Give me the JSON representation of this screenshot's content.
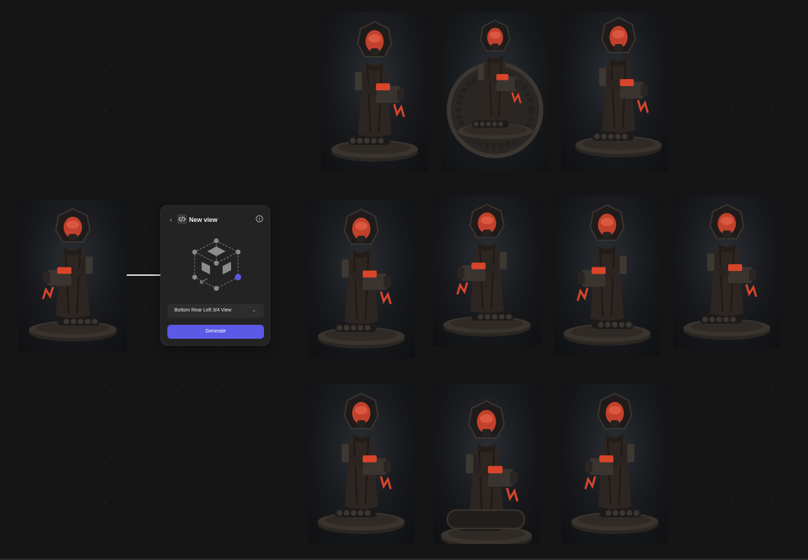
{
  "canvas": {
    "background": "#151515"
  },
  "node": {
    "title": "New view",
    "back_icon": "chevron-left-icon",
    "node_icon": "code-view-icon",
    "info_icon": "info-icon",
    "view_selector": {
      "icon": "cube-view-icon",
      "selected_point": "bottom-rear-left"
    },
    "view_dropdown": {
      "selected": "Bottom Rear Left 3/4 View",
      "chevron": "chevron-down-icon"
    },
    "generate_label": "Generate",
    "accent": "#5b5ae6"
  },
  "images": [
    {
      "id": "source-image"
    },
    {
      "id": "generated-1"
    },
    {
      "id": "generated-2"
    },
    {
      "id": "generated-3"
    },
    {
      "id": "generated-4"
    },
    {
      "id": "generated-5"
    },
    {
      "id": "generated-6"
    },
    {
      "id": "generated-7"
    },
    {
      "id": "generated-8"
    },
    {
      "id": "generated-9"
    },
    {
      "id": "generated-10"
    }
  ]
}
